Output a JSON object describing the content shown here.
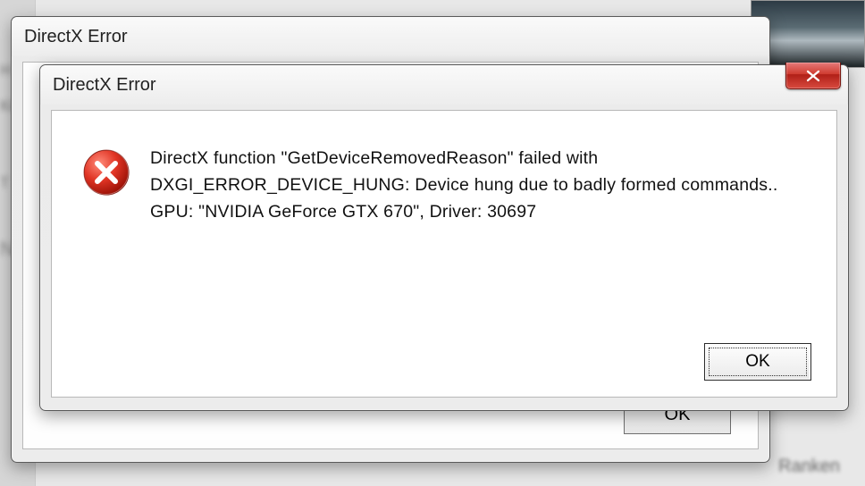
{
  "back_dialog": {
    "title": "DirectX Error",
    "ok_label": "OK"
  },
  "front_dialog": {
    "title": "DirectX Error",
    "close_tooltip": "Close",
    "message": "DirectX function \"GetDeviceRemovedReason\" failed with DXGI_ERROR_DEVICE_HUNG: Device hung due to badly formed commands.. GPU: \"NVIDIA GeForce GTX 670\", Driver: 30697",
    "ok_label": "OK",
    "icon_name": "error-icon"
  },
  "background": {
    "ranken_text": "Ranken"
  }
}
